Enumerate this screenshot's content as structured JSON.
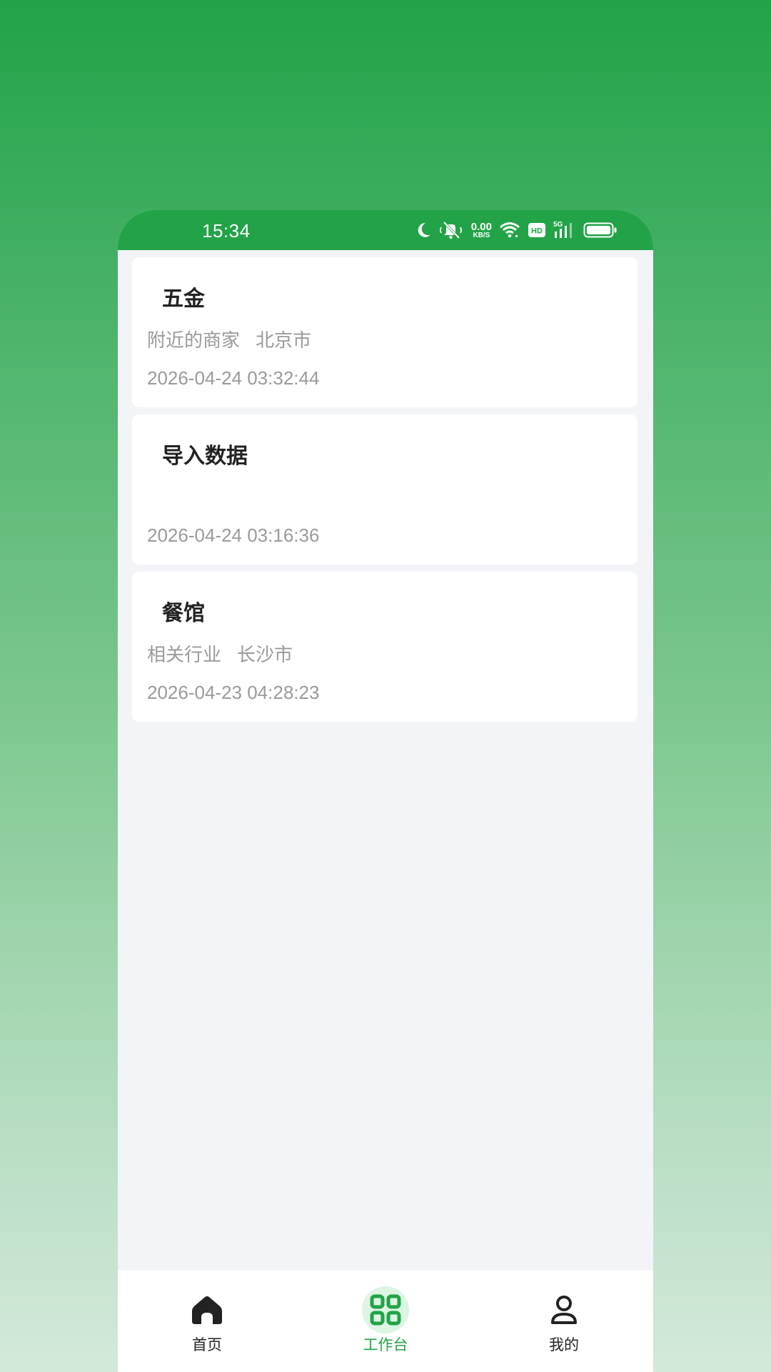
{
  "status_bar": {
    "time": "15:34",
    "net_speed_value": "0.00",
    "net_speed_unit": "KB/S",
    "hd_label": "HD",
    "signal_label": "5G",
    "icons": [
      "moon-icon",
      "mute-bell-icon",
      "wifi-icon",
      "hd-icon",
      "signal-5g-icon",
      "battery-icon"
    ]
  },
  "cards": [
    {
      "title": "五金",
      "meta": [
        "附近的商家",
        "北京市"
      ],
      "time": "2026-04-24 03:32:44"
    },
    {
      "title": "导入数据",
      "meta": [],
      "time": "2026-04-24 03:16:36"
    },
    {
      "title": "餐馆",
      "meta": [
        "相关行业",
        "长沙市"
      ],
      "time": "2026-04-23 04:28:23"
    }
  ],
  "tabbar": {
    "items": [
      {
        "label": "首页",
        "icon": "home-icon",
        "active": false
      },
      {
        "label": "工作台",
        "icon": "grid-icon",
        "active": true
      },
      {
        "label": "我的",
        "icon": "user-icon",
        "active": false
      }
    ]
  },
  "colors": {
    "brand": "#22a347",
    "active_tab_bg": "#ddf5e3",
    "text_primary": "#222222",
    "text_secondary": "#9a9a9a",
    "page_bg": "#f2f4f8"
  }
}
